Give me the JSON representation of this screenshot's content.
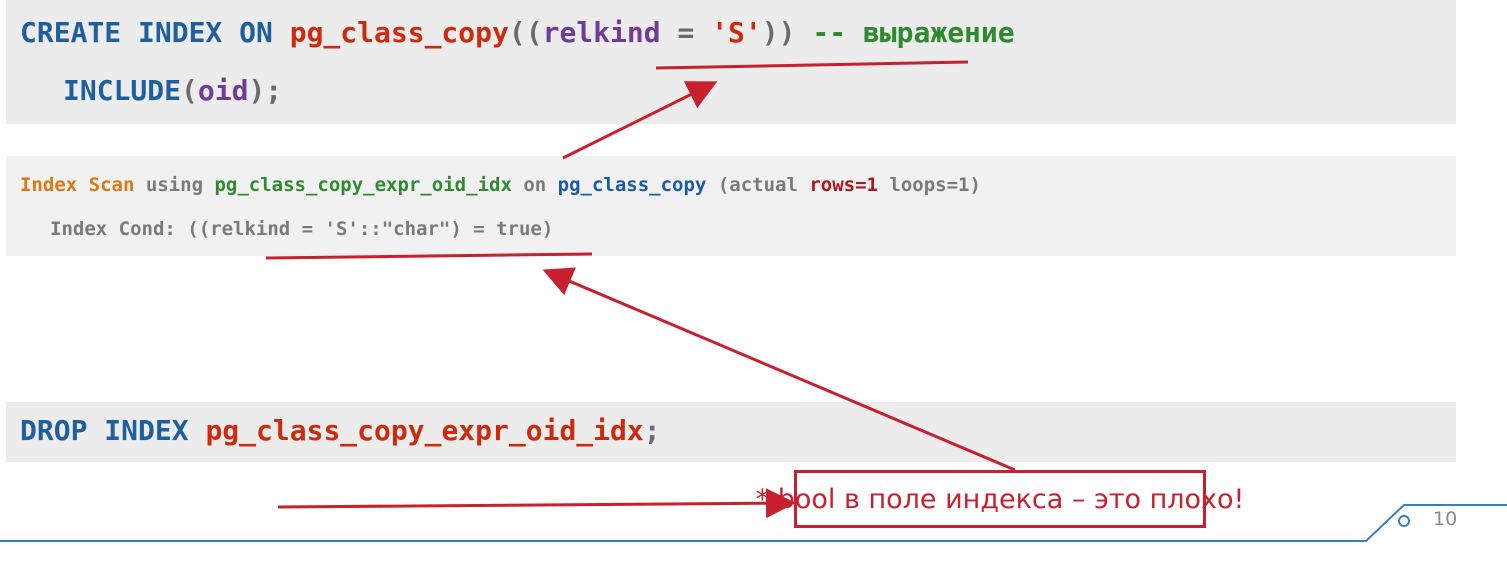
{
  "create": {
    "line1": {
      "create_index_on": "CREATE INDEX ON ",
      "table": "pg_class_copy",
      "open": "((",
      "column": "relkind",
      "eq": " = ",
      "literal": "'S'",
      "close": "))",
      "comment": " -- выражение"
    },
    "line2": {
      "include": "INCLUDE",
      "open": "(",
      "column": "oid",
      "close": ");"
    }
  },
  "explain": {
    "line1": {
      "index_scan": "Index Scan",
      "using": " using ",
      "index_name": "pg_class_copy_expr_oid_idx",
      "on": " on ",
      "table": "pg_class_copy",
      "actual": " (actual ",
      "rows": "rows=1",
      "loops": " loops=1)"
    },
    "line2": "Index Cond: ((relkind = 'S'::\"char\") = true)"
  },
  "drop": {
    "drop_index": "DROP INDEX ",
    "index_name": "pg_class_copy_expr_oid_idx",
    "semicolon": ";"
  },
  "note": "* bool в поле индекса – это плохо!",
  "page_number": "10",
  "colors": {
    "annotation_red": "#c8202f",
    "keyword_blue": "#1f5f9e",
    "identifier_red": "#d02a0e",
    "column_purple": "#6f3d99",
    "comment_green": "#2e8b2e",
    "footer_line_blue": "#3b7fb8"
  }
}
